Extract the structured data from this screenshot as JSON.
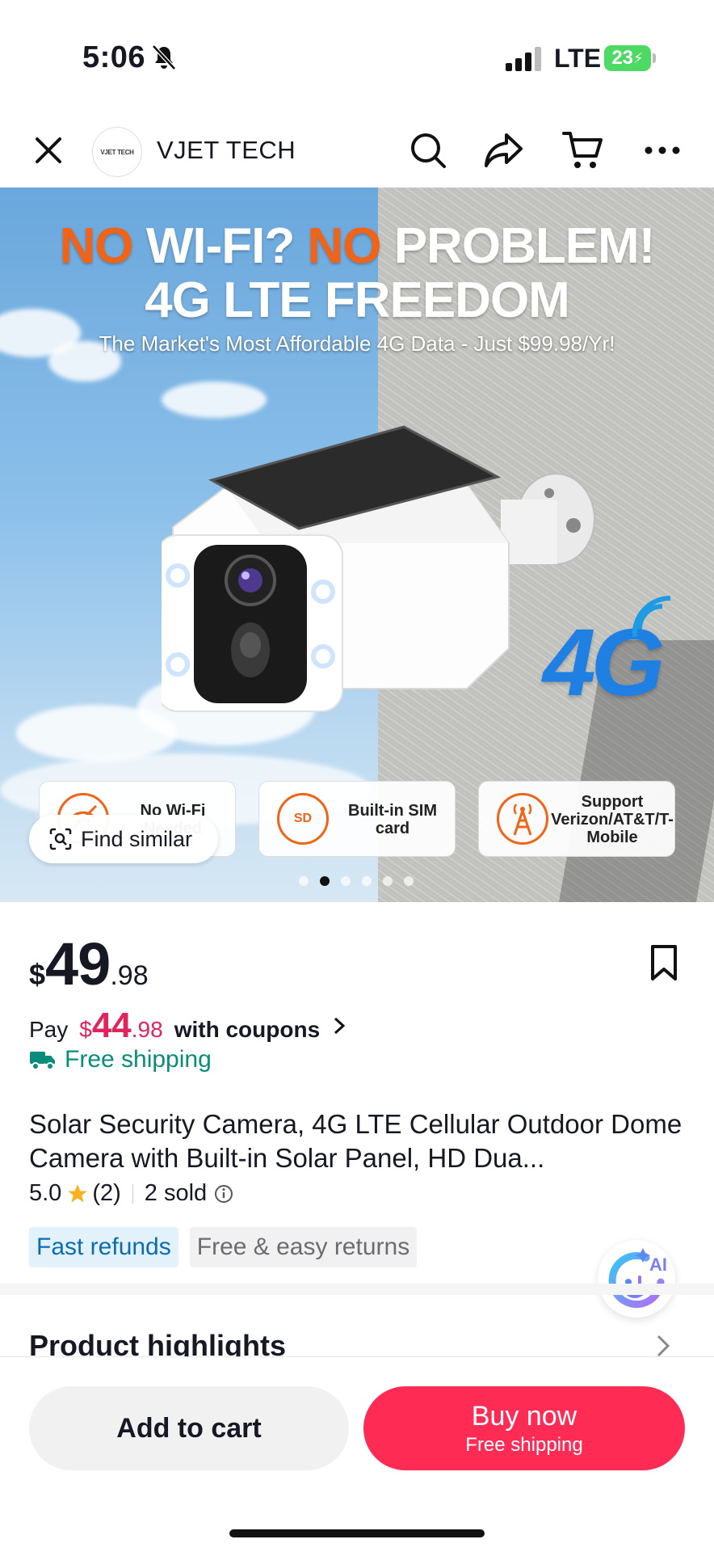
{
  "status_bar": {
    "time": "5:06",
    "network": "LTE",
    "battery": "23"
  },
  "header": {
    "shop_logo": "VJET TECH",
    "shop_name": "VJET TECH"
  },
  "hero": {
    "headline_line1": [
      {
        "text": "NO ",
        "color": "orange"
      },
      {
        "text": "WI-FI? ",
        "color": "white"
      },
      {
        "text": "NO ",
        "color": "orange"
      },
      {
        "text": "PROBLEM!",
        "color": "white"
      }
    ],
    "headline_line2": "4G LTE FREEDOM",
    "subheadline": "The Market's Most Affordable 4G Data - Just $99.98/Yr!",
    "badge": "4G",
    "features": [
      {
        "icon": "no-wifi-icon",
        "text": "No Wi-Fi Needed"
      },
      {
        "icon": "sd-card-icon",
        "icon_text": "SD",
        "text": "Built-in SIM card"
      },
      {
        "icon": "cell-tower-icon",
        "text": "Support Verizon/AT&T/T-Mobile"
      }
    ],
    "find_similar": "Find similar",
    "carousel": {
      "count": 6,
      "active_index": 1
    }
  },
  "product": {
    "currency": "$",
    "price_int": "49",
    "price_dec": ".98",
    "coupon_prefix": "Pay",
    "coupon_currency": "$",
    "coupon_int": "44",
    "coupon_dec": ".98",
    "coupon_suffix": "with coupons",
    "shipping": "Free shipping",
    "title": "Solar Security Camera, 4G LTE Cellular Outdoor Dome Camera with Built-in Solar Panel, HD Dua...",
    "rating": "5.0",
    "review_count": "(2)",
    "sold": "2 sold",
    "tags": [
      "Fast refunds",
      "Free & easy returns"
    ],
    "ai_label": "AI"
  },
  "sections": {
    "highlights": "Product highlights"
  },
  "actions": {
    "add_to_cart": "Add to cart",
    "buy_now": "Buy now",
    "buy_now_sub": "Free shipping"
  },
  "colors": {
    "accent": "#fe2c55",
    "coupon": "#e0245e",
    "shipping": "#0a8c7b",
    "hero_orange": "#f06419"
  }
}
